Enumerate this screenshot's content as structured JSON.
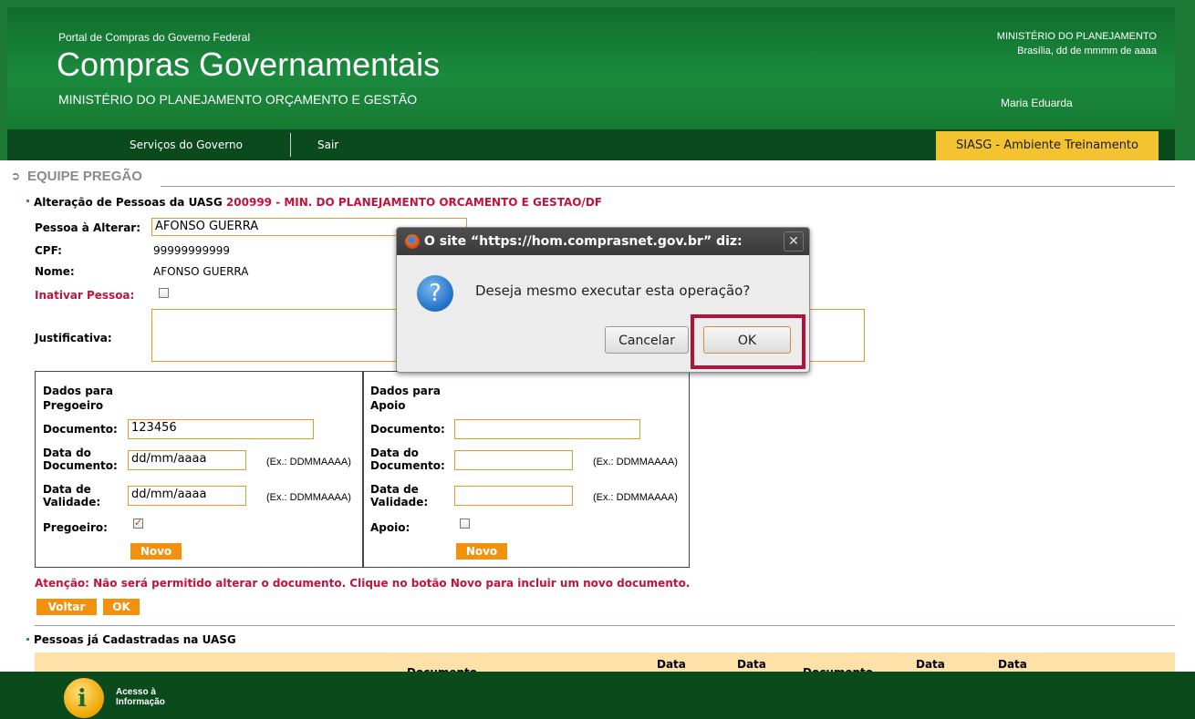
{
  "header": {
    "portal_label": "Portal de Compras do Governo Federal",
    "site_title": "Compras Governamentais",
    "ministry": "MINISTÉRIO DO PLANEJAMENTO ORÇAMENTO E GESTÃO",
    "right_ministry": "MINISTÉRIO DO PLANEJAMENTO",
    "right_date": "Brasília, dd de mmmm de aaaa",
    "user_name": "Maria Eduarda"
  },
  "nav": {
    "items": [
      "Serviços do Governo",
      "Sair"
    ],
    "environment": "SIASG - Ambiente Treinamento"
  },
  "section_title": "EQUIPE PREGÃO",
  "form": {
    "subtitle_prefix": "Alteração de Pessoas da UASG",
    "subtitle_uasg": "200999 - MIN. DO PLANEJAMENTO ORCAMENTO E GESTAO/DF",
    "pessoa_label": "Pessoa à Alterar:",
    "pessoa_value": "AFONSO GUERRA",
    "cpf_label": "CPF:",
    "cpf_value": "99999999999",
    "nome_label": "Nome:",
    "nome_value": "AFONSO GUERRA",
    "inativar_label": "Inativar Pessoa:",
    "justificativa_label": "Justificativa:"
  },
  "pregoeiro": {
    "title": [
      "Dados para",
      "Pregoeiro"
    ],
    "documento_label": "Documento:",
    "documento_value": "123456",
    "data_doc_label": [
      "Data do",
      "Documento:"
    ],
    "data_doc_value": "dd/mm/aaaa",
    "data_val_label": [
      "Data de",
      "Validade:"
    ],
    "data_val_value": "dd/mm/aaaa",
    "hint": "(Ex.: DDMMAAAA)",
    "check_label": "Pregoeiro:",
    "checked": true,
    "novo_button": "Novo"
  },
  "apoio": {
    "title": [
      "Dados para",
      "Apoio"
    ],
    "documento_label": "Documento:",
    "documento_value": "",
    "data_doc_label": [
      "Data do",
      "Documento:"
    ],
    "data_val_label": [
      "Data de",
      "Validade:"
    ],
    "hint": "(Ex.: DDMMAAAA)",
    "check_label": "Apoio:",
    "checked": false,
    "novo_button": "Novo"
  },
  "warning": "Atenção: Não será permitido alterar o documento. Clique no botão Novo para incluir um novo documento.",
  "actions": {
    "voltar": "Voltar",
    "ok": "OK"
  },
  "list": {
    "title": "Pessoas já Cadastradas na UASG",
    "headers": [
      "Documento",
      "Data",
      "Data",
      "Documento",
      "Data",
      "Data"
    ]
  },
  "footer": {
    "access_info": [
      "Acesso à",
      "Informação"
    ]
  },
  "dialog": {
    "title": "O site “https://hom.comprasnet.gov.br” diz:",
    "message": "Deseja mesmo executar esta operação?",
    "cancel": "Cancelar",
    "ok": "OK"
  },
  "colors": {
    "header_green": "#1b8a3d",
    "nav_dark": "#0b4a1d",
    "accent_orange": "#f3910f",
    "env_yellow": "#f4c430",
    "highlight_red": "#b0123a"
  }
}
